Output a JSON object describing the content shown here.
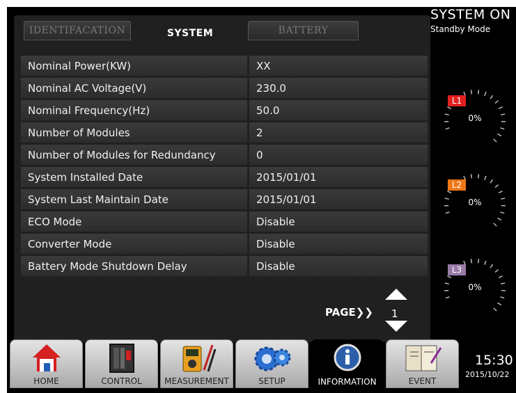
{
  "status": {
    "title": "SYSTEM ON",
    "mode": "Standby Mode"
  },
  "tabs": [
    "IDENTIFACATION",
    "SYSTEM",
    "BATTERY"
  ],
  "rows": [
    {
      "label": "Nominal Power(KW)",
      "value": "XX"
    },
    {
      "label": "Nominal AC Voltage(V)",
      "value": "230.0"
    },
    {
      "label": "Nominal Frequency(Hz)",
      "value": "50.0"
    },
    {
      "label": "Number of Modules",
      "value": "2"
    },
    {
      "label": "Number of Modules for Redundancy",
      "value": "0"
    },
    {
      "label": "System Installed Date",
      "value": "2015/01/01"
    },
    {
      "label": "System Last Maintain Date",
      "value": "2015/01/01"
    },
    {
      "label": "ECO Mode",
      "value": "Disable"
    },
    {
      "label": "Converter Mode",
      "value": "Disable"
    },
    {
      "label": "Battery Mode Shutdown Delay",
      "value": "Disable"
    }
  ],
  "pager": {
    "label": "PAGE",
    "arrows": "❯❯",
    "page": "1"
  },
  "gauges": [
    {
      "badge": "L1",
      "value": "0%",
      "level": 0,
      "color": "#e02020"
    },
    {
      "badge": "L2",
      "value": "0%",
      "level": 0,
      "color": "#f07818"
    },
    {
      "badge": "L3",
      "value": "0%",
      "level": 0,
      "color": "#9a7aa8"
    }
  ],
  "clock": {
    "time": "15:30",
    "date": "2015/10/22"
  },
  "nav": [
    {
      "label": "HOME",
      "icon": "home-icon"
    },
    {
      "label": "CONTROL",
      "icon": "breaker-panel-icon"
    },
    {
      "label": "MEASUREMENT",
      "icon": "multimeter-icon"
    },
    {
      "label": "SETUP",
      "icon": "gears-icon"
    },
    {
      "label": "INFORMATION",
      "icon": "info-icon"
    },
    {
      "label": "EVENT",
      "icon": "event-log-icon"
    }
  ],
  "colors": {
    "tab_active_text": "#ffffff",
    "row_bg": "#333333",
    "screen_bg": "#000000"
  }
}
